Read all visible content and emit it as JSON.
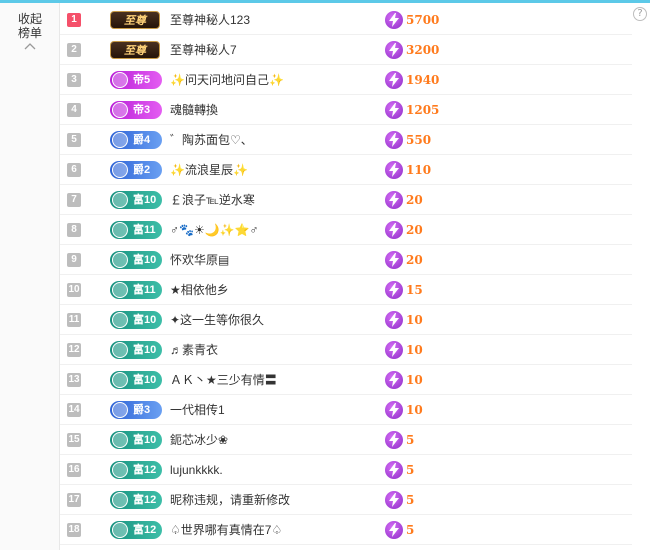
{
  "sidebar": {
    "collapse_label": "收起榜单"
  },
  "help_label": "?",
  "rows": [
    {
      "rank": "1",
      "badge": "至尊",
      "type": "zhizun",
      "name": "至尊神秘人123",
      "score": "5700"
    },
    {
      "rank": "2",
      "badge": "至尊",
      "type": "zhizun",
      "name": "至尊神秘人7",
      "score": "3200"
    },
    {
      "rank": "3",
      "badge": "帝5",
      "type": "di",
      "name": "✨问天问地问自己✨",
      "score": "1940"
    },
    {
      "rank": "4",
      "badge": "帝3",
      "type": "di",
      "name": "魂髓轉換",
      "score": "1205"
    },
    {
      "rank": "5",
      "badge": "爵4",
      "type": "jue",
      "name": "゛陶苏面包♡、",
      "score": "550"
    },
    {
      "rank": "6",
      "badge": "爵2",
      "type": "jue",
      "name": "✨流浪星辰✨",
      "score": "110"
    },
    {
      "rank": "7",
      "badge": "富10",
      "type": "fu",
      "name": "￡浪子℡逆水寒",
      "score": "20"
    },
    {
      "rank": "8",
      "badge": "富11",
      "type": "fu",
      "name": "♂🐾☀🌙✨⭐♂",
      "score": "20"
    },
    {
      "rank": "9",
      "badge": "富10",
      "type": "fu",
      "name": "怀欢华原▤",
      "score": "20"
    },
    {
      "rank": "10",
      "badge": "富11",
      "type": "fu",
      "name": "★相依他乡",
      "score": "15"
    },
    {
      "rank": "11",
      "badge": "富10",
      "type": "fu",
      "name": "✦这一生等你很久",
      "score": "10"
    },
    {
      "rank": "12",
      "badge": "富10",
      "type": "fu",
      "name": "♬素青衣",
      "score": "10"
    },
    {
      "rank": "13",
      "badge": "富10",
      "type": "fu",
      "name": "ＡＫ丶★三少有情〓",
      "score": "10"
    },
    {
      "rank": "14",
      "badge": "爵3",
      "type": "jue",
      "name": "一代相传1",
      "score": "10"
    },
    {
      "rank": "15",
      "badge": "富10",
      "type": "fu",
      "name": "鈪芯冰少❀",
      "score": "5"
    },
    {
      "rank": "16",
      "badge": "富12",
      "type": "fu",
      "name": "lujunkkkk.",
      "score": "5"
    },
    {
      "rank": "17",
      "badge": "富12",
      "type": "fu",
      "name": "昵称违规，请重新修改",
      "score": "5"
    },
    {
      "rank": "18",
      "badge": "富12",
      "type": "fu",
      "name": "♤世界哪有真情在7♤",
      "score": "5"
    }
  ]
}
